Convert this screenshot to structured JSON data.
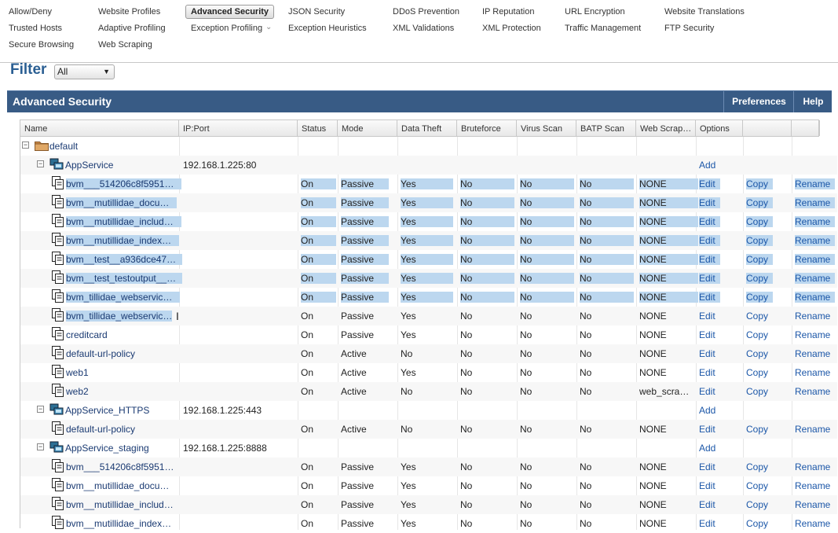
{
  "nav": {
    "col1": [
      "Allow/Deny",
      "Trusted Hosts",
      "Secure Browsing"
    ],
    "col2": [
      "Website Profiles",
      "Adaptive Profiling",
      "Web Scraping"
    ],
    "col3": [
      "Advanced Security",
      "Exception Profiling"
    ],
    "col4": [
      "JSON Security",
      "Exception Heuristics"
    ],
    "col5": [
      "DDoS Prevention",
      "XML Validations"
    ],
    "col6": [
      "IP Reputation",
      "XML Protection"
    ],
    "col7": [
      "URL Encryption",
      "Traffic Management"
    ],
    "col8": [
      "Website Translations",
      "FTP Security"
    ],
    "active": "Advanced Security"
  },
  "filter": {
    "label": "Filter",
    "value": "All"
  },
  "panel": {
    "title": "Advanced Security",
    "preferences": "Preferences",
    "help": "Help"
  },
  "columns": [
    "Name",
    "IP:Port",
    "Status",
    "Mode",
    "Data Theft",
    "Bruteforce",
    "Virus Scan",
    "BATP Scan",
    "Web Scrap…",
    "Options",
    "",
    ""
  ],
  "rows": [
    {
      "type": "root",
      "name": "default"
    },
    {
      "type": "service",
      "name": "AppService",
      "ip": "192.168.1.225:80",
      "add": "Add"
    },
    {
      "type": "policy",
      "name": "bvm___514206c8f5951…",
      "status": "On",
      "mode": "Passive",
      "data_theft": "Yes",
      "bruteforce": "No",
      "virus": "No",
      "batp": "No",
      "web": "NONE",
      "edit": "Edit",
      "copy": "Copy",
      "rename": "Rename",
      "selected": true
    },
    {
      "type": "policy",
      "name": "bvm__mutillidae_docu…",
      "status": "On",
      "mode": "Passive",
      "data_theft": "Yes",
      "bruteforce": "No",
      "virus": "No",
      "batp": "No",
      "web": "NONE",
      "edit": "Edit",
      "copy": "Copy",
      "rename": "Rename",
      "selected": true
    },
    {
      "type": "policy",
      "name": "bvm__mutillidae_includ…",
      "status": "On",
      "mode": "Passive",
      "data_theft": "Yes",
      "bruteforce": "No",
      "virus": "No",
      "batp": "No",
      "web": "NONE",
      "edit": "Edit",
      "copy": "Copy",
      "rename": "Rename",
      "selected": true
    },
    {
      "type": "policy",
      "name": "bvm__mutillidae_index…",
      "status": "On",
      "mode": "Passive",
      "data_theft": "Yes",
      "bruteforce": "No",
      "virus": "No",
      "batp": "No",
      "web": "NONE",
      "edit": "Edit",
      "copy": "Copy",
      "rename": "Rename",
      "selected": true
    },
    {
      "type": "policy",
      "name": "bvm__test__a936dce47…",
      "status": "On",
      "mode": "Passive",
      "data_theft": "Yes",
      "bruteforce": "No",
      "virus": "No",
      "batp": "No",
      "web": "NONE",
      "edit": "Edit",
      "copy": "Copy",
      "rename": "Rename",
      "selected": true
    },
    {
      "type": "policy",
      "name": "bvm__test_testoutput__…",
      "status": "On",
      "mode": "Passive",
      "data_theft": "Yes",
      "bruteforce": "No",
      "virus": "No",
      "batp": "No",
      "web": "NONE",
      "edit": "Edit",
      "copy": "Copy",
      "rename": "Rename",
      "selected": true
    },
    {
      "type": "policy",
      "name": "bvm_tillidae_webservic…",
      "status": "On",
      "mode": "Passive",
      "data_theft": "Yes",
      "bruteforce": "No",
      "virus": "No",
      "batp": "No",
      "web": "NONE",
      "edit": "Edit",
      "copy": "Copy",
      "rename": "Rename",
      "selected": true
    },
    {
      "type": "policy",
      "name": "bvm_tillidae_webservic…",
      "status": "On",
      "mode": "Passive",
      "data_theft": "Yes",
      "bruteforce": "No",
      "virus": "No",
      "batp": "No",
      "web": "NONE",
      "edit": "Edit",
      "copy": "Copy",
      "rename": "Rename",
      "partial": true
    },
    {
      "type": "policy",
      "name": "creditcard",
      "status": "On",
      "mode": "Passive",
      "data_theft": "Yes",
      "bruteforce": "No",
      "virus": "No",
      "batp": "No",
      "web": "NONE",
      "edit": "Edit",
      "copy": "Copy",
      "rename": "Rename"
    },
    {
      "type": "policy",
      "name": "default-url-policy",
      "status": "On",
      "mode": "Active",
      "data_theft": "No",
      "bruteforce": "No",
      "virus": "No",
      "batp": "No",
      "web": "NONE",
      "edit": "Edit",
      "copy": "Copy",
      "rename": "Rename"
    },
    {
      "type": "policy",
      "name": "web1",
      "status": "On",
      "mode": "Active",
      "data_theft": "Yes",
      "bruteforce": "No",
      "virus": "No",
      "batp": "No",
      "web": "NONE",
      "edit": "Edit",
      "copy": "Copy",
      "rename": "Rename"
    },
    {
      "type": "policy",
      "name": "web2",
      "status": "On",
      "mode": "Active",
      "data_theft": "No",
      "bruteforce": "No",
      "virus": "No",
      "batp": "No",
      "web": "web_scra…",
      "edit": "Edit",
      "copy": "Copy",
      "rename": "Rename"
    },
    {
      "type": "service",
      "name": "AppService_HTTPS",
      "ip": "192.168.1.225:443",
      "add": "Add"
    },
    {
      "type": "policy",
      "name": "default-url-policy",
      "status": "On",
      "mode": "Active",
      "data_theft": "No",
      "bruteforce": "No",
      "virus": "No",
      "batp": "No",
      "web": "NONE",
      "edit": "Edit",
      "copy": "Copy",
      "rename": "Rename"
    },
    {
      "type": "service",
      "name": "AppService_staging",
      "ip": "192.168.1.225:8888",
      "add": "Add"
    },
    {
      "type": "policy",
      "name": "bvm___514206c8f5951…",
      "status": "On",
      "mode": "Passive",
      "data_theft": "Yes",
      "bruteforce": "No",
      "virus": "No",
      "batp": "No",
      "web": "NONE",
      "edit": "Edit",
      "copy": "Copy",
      "rename": "Rename"
    },
    {
      "type": "policy",
      "name": "bvm__mutillidae_docu…",
      "status": "On",
      "mode": "Passive",
      "data_theft": "Yes",
      "bruteforce": "No",
      "virus": "No",
      "batp": "No",
      "web": "NONE",
      "edit": "Edit",
      "copy": "Copy",
      "rename": "Rename"
    },
    {
      "type": "policy",
      "name": "bvm__mutillidae_includ…",
      "status": "On",
      "mode": "Passive",
      "data_theft": "Yes",
      "bruteforce": "No",
      "virus": "No",
      "batp": "No",
      "web": "NONE",
      "edit": "Edit",
      "copy": "Copy",
      "rename": "Rename"
    },
    {
      "type": "policy",
      "name": "bvm__mutillidae_index…",
      "status": "On",
      "mode": "Passive",
      "data_theft": "Yes",
      "bruteforce": "No",
      "virus": "No",
      "batp": "No",
      "web": "NONE",
      "edit": "Edit",
      "copy": "Copy",
      "rename": "Rename"
    }
  ],
  "colors": {
    "panel_bar": "#385b85",
    "link": "#1c57a8",
    "selection": "#bcd7ef",
    "filter_label": "#2b5f93"
  },
  "icons": {
    "folder": "folder-icon",
    "service": "network-service-icon",
    "policy": "policy-document-icon",
    "toggle": "collapse-toggle-icon"
  }
}
